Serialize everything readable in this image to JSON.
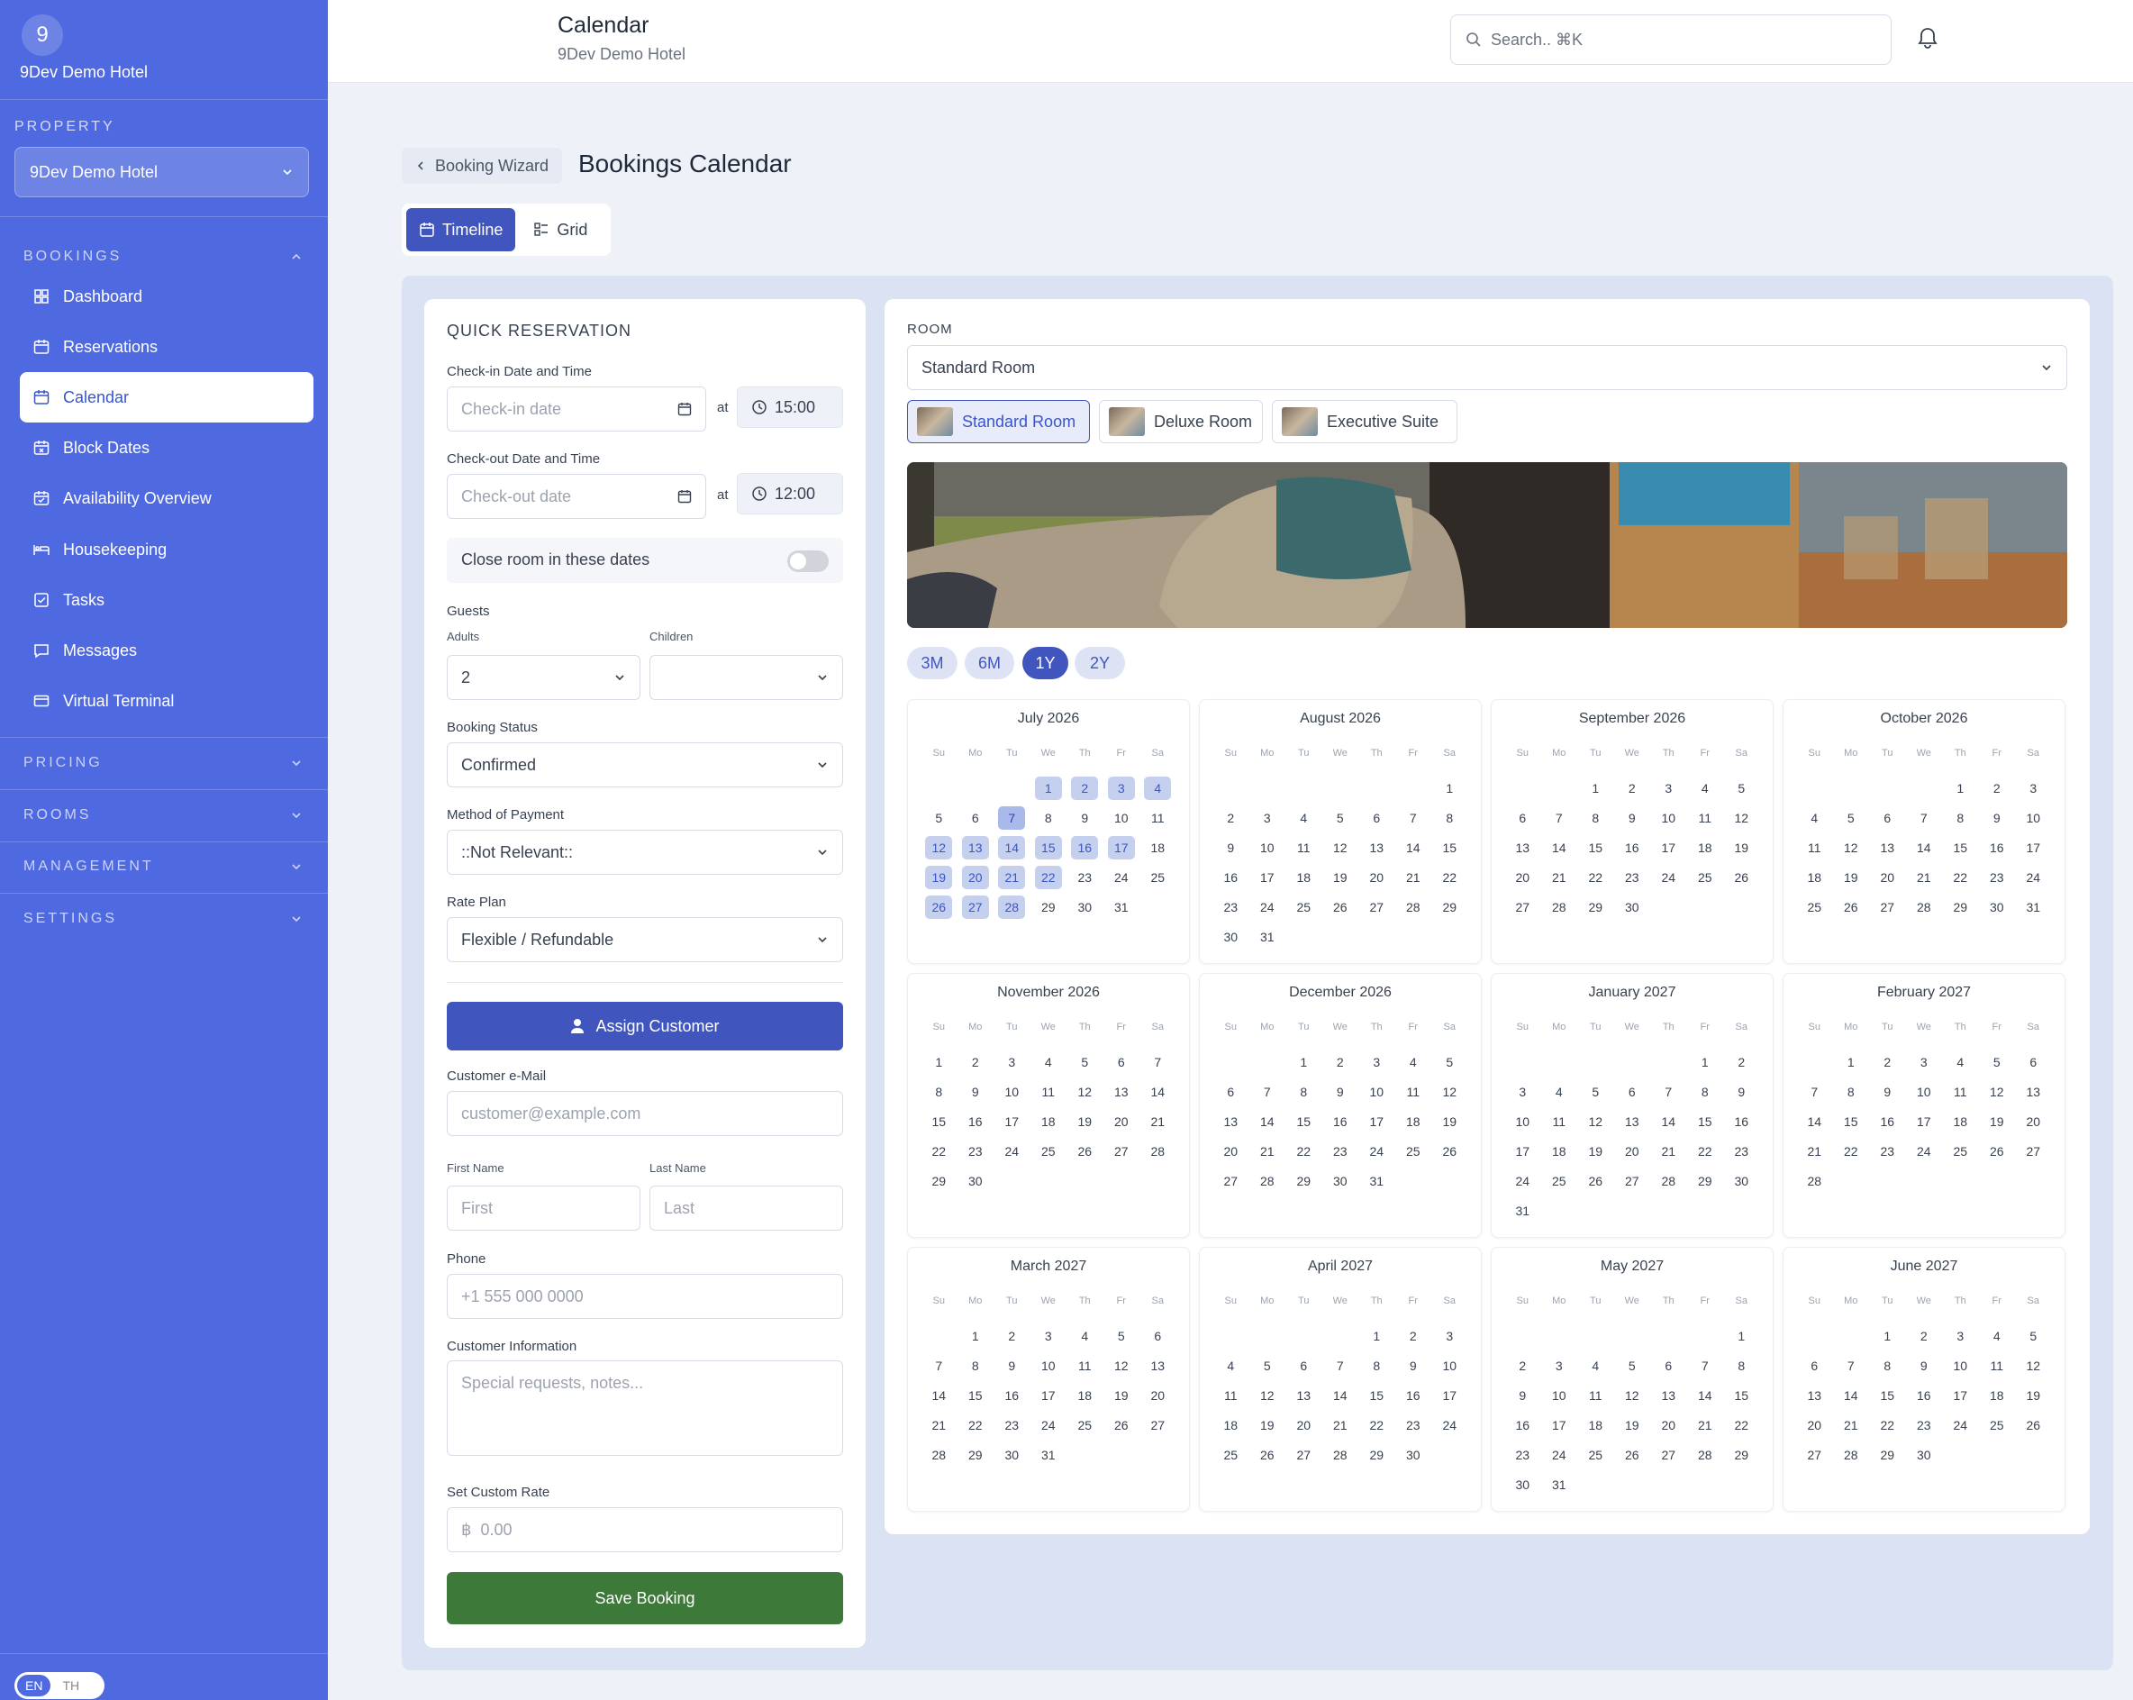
{
  "sidebar": {
    "logo_initial": "9",
    "hotel_name": "9Dev Demo Hotel",
    "property_label": "PROPERTY",
    "property_value": "9Dev Demo Hotel",
    "groups": {
      "bookings": "BOOKINGS",
      "pricing": "PRICING",
      "rooms": "ROOMS",
      "management": "MANAGEMENT",
      "settings": "SETTINGS"
    },
    "items": [
      {
        "label": "Dashboard",
        "icon": "grid-icon"
      },
      {
        "label": "Reservations",
        "icon": "calendar-icon"
      },
      {
        "label": "Calendar",
        "icon": "calendar-icon",
        "active": true
      },
      {
        "label": "Block Dates",
        "icon": "calendar-block-icon"
      },
      {
        "label": "Availability Overview",
        "icon": "calendar-check-icon"
      },
      {
        "label": "Housekeeping",
        "icon": "bed-icon"
      },
      {
        "label": "Tasks",
        "icon": "checkbox-icon"
      },
      {
        "label": "Messages",
        "icon": "message-icon"
      },
      {
        "label": "Virtual Terminal",
        "icon": "card-icon"
      }
    ],
    "lang": {
      "en": "EN",
      "th": "TH"
    }
  },
  "topbar": {
    "title": "Calendar",
    "subtitle": "9Dev Demo Hotel",
    "search_placeholder": "Search.. ⌘K"
  },
  "header": {
    "back_label": "Booking Wizard",
    "page_title": "Bookings Calendar",
    "view_timeline": "Timeline",
    "view_grid": "Grid"
  },
  "form": {
    "title": "QUICK RESERVATION",
    "checkin_label": "Check-in Date and Time",
    "checkin_placeholder": "Check-in date",
    "checkin_time": "15:00",
    "checkout_label": "Check-out Date and Time",
    "checkout_placeholder": "Check-out date",
    "checkout_time": "12:00",
    "at": "at",
    "close_room_label": "Close room in these dates",
    "guests_label": "Guests",
    "adults_label": "Adults",
    "adults_value": "2",
    "children_label": "Children",
    "children_value": "",
    "status_label": "Booking Status",
    "status_value": "Confirmed",
    "payment_label": "Method of Payment",
    "payment_value": "::Not Relevant::",
    "rate_label": "Rate Plan",
    "rate_value": "Flexible / Refundable",
    "assign_button": "Assign Customer",
    "email_label": "Customer e-Mail",
    "email_placeholder": "customer@example.com",
    "first_label": "First Name",
    "first_placeholder": "First",
    "last_label": "Last Name",
    "last_placeholder": "Last",
    "phone_label": "Phone",
    "phone_placeholder": "+1 555 000 0000",
    "info_label": "Customer Information",
    "info_placeholder": "Special requests, notes...",
    "custom_rate_label": "Set Custom Rate",
    "currency_symbol": "฿",
    "custom_rate_placeholder": "0.00",
    "save_button": "Save Booking"
  },
  "room": {
    "label": "ROOM",
    "selected": "Standard Room",
    "chips": [
      "Standard Room",
      "Deluxe Room",
      "Executive Suite"
    ]
  },
  "ranges": [
    "3M",
    "6M",
    "1Y",
    "2Y"
  ],
  "active_range": "1Y",
  "weekdays": [
    "Su",
    "Mo",
    "Tu",
    "We",
    "Th",
    "Fr",
    "Sa"
  ],
  "months": [
    {
      "name": "July 2026",
      "start": 3,
      "days": 31,
      "highlight": [
        1,
        2,
        3,
        4,
        7,
        12,
        13,
        14,
        15,
        16,
        17,
        19,
        20,
        21,
        22,
        26,
        27,
        28
      ],
      "today": 7
    },
    {
      "name": "August 2026",
      "start": 6,
      "days": 31
    },
    {
      "name": "September 2026",
      "start": 2,
      "days": 30
    },
    {
      "name": "October 2026",
      "start": 4,
      "days": 31
    },
    {
      "name": "November 2026",
      "start": 0,
      "days": 30
    },
    {
      "name": "December 2026",
      "start": 2,
      "days": 31
    },
    {
      "name": "January 2027",
      "start": 5,
      "days": 31
    },
    {
      "name": "February 2027",
      "start": 1,
      "days": 28
    },
    {
      "name": "March 2027",
      "start": 1,
      "days": 31
    },
    {
      "name": "April 2027",
      "start": 4,
      "days": 30
    },
    {
      "name": "May 2027",
      "start": 6,
      "days": 31
    },
    {
      "name": "June 2027",
      "start": 2,
      "days": 30
    }
  ],
  "colors": {
    "sidebar": "#4f6ae0",
    "accent": "#4056be",
    "save": "#3d7a3a"
  }
}
